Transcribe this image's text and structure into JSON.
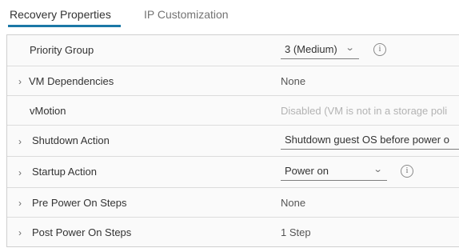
{
  "tabs": [
    {
      "label": "Recovery Properties",
      "active": true
    },
    {
      "label": "IP Customization",
      "active": false
    }
  ],
  "colors": {
    "accent": "#1b78a6"
  },
  "rows": {
    "priority_group": {
      "label": "Priority Group",
      "value": "3 (Medium)"
    },
    "vm_dependencies": {
      "label": "VM Dependencies",
      "value": "None"
    },
    "vmotion": {
      "label": "vMotion",
      "value": "Disabled (VM is not in a storage poli"
    },
    "shutdown_action": {
      "label": "Shutdown Action",
      "value": "Shutdown guest OS before power o"
    },
    "startup_action": {
      "label": "Startup Action",
      "value": "Power on"
    },
    "pre_power_on_steps": {
      "label": "Pre Power On Steps",
      "value": "None"
    },
    "post_power_on_steps": {
      "label": "Post Power On Steps",
      "value": "1 Step"
    }
  },
  "icons": {
    "expand": "chevron-right-icon",
    "dropdown": "chevron-down-icon",
    "info": "info-icon"
  }
}
